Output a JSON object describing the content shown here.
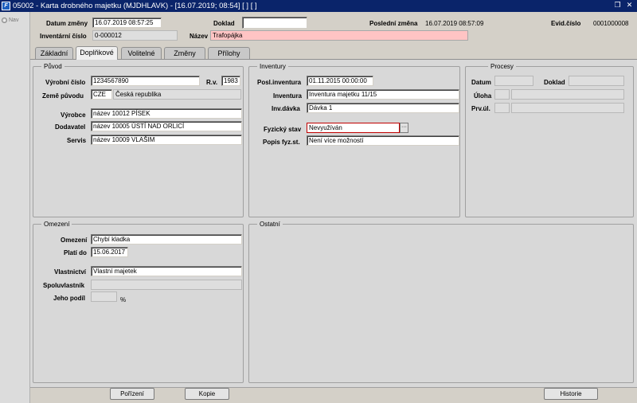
{
  "window": {
    "title": "05002 - Karta drobného majetku (MJDHLAVK) - [16.07.2019; 08:54]  [ ]  [ ]",
    "app_icon": "F"
  },
  "leftnav": {
    "label": "Nav"
  },
  "header": {
    "datum_zmeny_label": "Datum změny",
    "datum_zmeny_value": "16.07.2019 08:57:25",
    "doklad_label": "Doklad",
    "doklad_value": "",
    "posledni_zmena_label": "Poslední změna",
    "posledni_zmena_value": "16.07.2019 08:57:09",
    "evid_cislo_label": "Evid.číslo",
    "evid_cislo_value": "0001000008",
    "inventarni_cislo_label": "Inventární číslo",
    "inventarni_cislo_value": "0-000012",
    "nazev_label": "Název",
    "nazev_value": "Trafopájka"
  },
  "tabs": [
    {
      "label": "Základní"
    },
    {
      "label": "Doplňkové"
    },
    {
      "label": "Volitelné"
    },
    {
      "label": "Změny"
    },
    {
      "label": "Přílohy"
    }
  ],
  "puvod": {
    "title": "Původ",
    "vyrobni_cislo_label": "Výrobní číslo",
    "vyrobni_cislo_value": "1234567890",
    "rv_label": "R.v.",
    "rv_value": "1983",
    "zeme_puvodu_label": "Země původu",
    "zeme_code": "CZE",
    "zeme_name": "Česká republika",
    "vyrobce_label": "Výrobce",
    "vyrobce_value": "název 10012  PÍSEK",
    "dodavatel_label": "Dodavatel",
    "dodavatel_value": "název 10005  ÚSTÍ NAD ORLICÍ",
    "servis_label": "Servis",
    "servis_value": "název 10009  VLAŠIM"
  },
  "inventury": {
    "title": "Inventury",
    "posl_inventura_label": "Posl.inventura",
    "posl_inventura_value": "01.11.2015 00:00:00",
    "inventura_label": "Inventura",
    "inventura_value": "Inventura majetku 11/15",
    "inv_davka_label": "Inv.dávka",
    "inv_davka_value": "Dávka 1",
    "fyzicky_stav_label": "Fyzický stav",
    "fyzicky_stav_value": "Nevyužíván",
    "lookup_btn": "···",
    "popis_label": "Popis fyz.st.",
    "popis_value": "Není více možností"
  },
  "procesy": {
    "title": "Procesy",
    "datum_label": "Datum",
    "doklad_label": "Doklad",
    "uloha_label": "Úloha",
    "prv_ul_label": "Prv.úl."
  },
  "omezeni": {
    "title": "Omezení",
    "omezeni_label": "Omezení",
    "omezeni_value": "Chybí kladka",
    "plati_do_label": "Platí do",
    "plati_do_value": "15.06.2017",
    "vlastnictvi_label": "Vlastnictví",
    "vlastnictvi_value": "Vlastní majetek",
    "spoluvlastnik_label": "Spoluvlastník",
    "spoluvlastnik_value": "",
    "jeho_podil_label": "Jeho podíl",
    "jeho_podil_value": "",
    "percent_sign": "%"
  },
  "ostatni": {
    "title": "Ostatní"
  },
  "buttons": {
    "porizeni": "Pořízení",
    "kopie": "Kopie",
    "historie": "Historie"
  }
}
